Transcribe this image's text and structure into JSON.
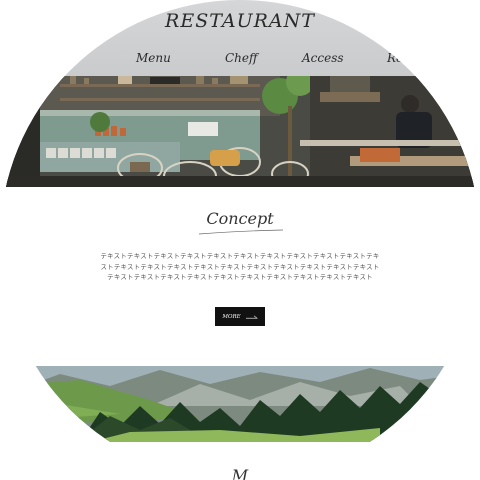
{
  "header": {
    "logo": "RESTAURANT",
    "nav": [
      {
        "label": "Menu"
      },
      {
        "label": "Cheff"
      },
      {
        "label": "Access"
      },
      {
        "label": "Re"
      }
    ]
  },
  "concept": {
    "title": "Concept",
    "body": "テキストテキストテキストテキストテキストテキストテキストテキストテキストテキストテキストテキストテキストテキストテキストテキストテキストテキストテキストテキストテキストテキストテキストテキストテキストテキストテキストテキストテキストテキストテキスト",
    "more_label": "MORE"
  },
  "next_section": {
    "title_peek": "M"
  },
  "colors": {
    "header_bg": "#cfd1d3",
    "button_bg": "#111111",
    "text": "#333333"
  }
}
